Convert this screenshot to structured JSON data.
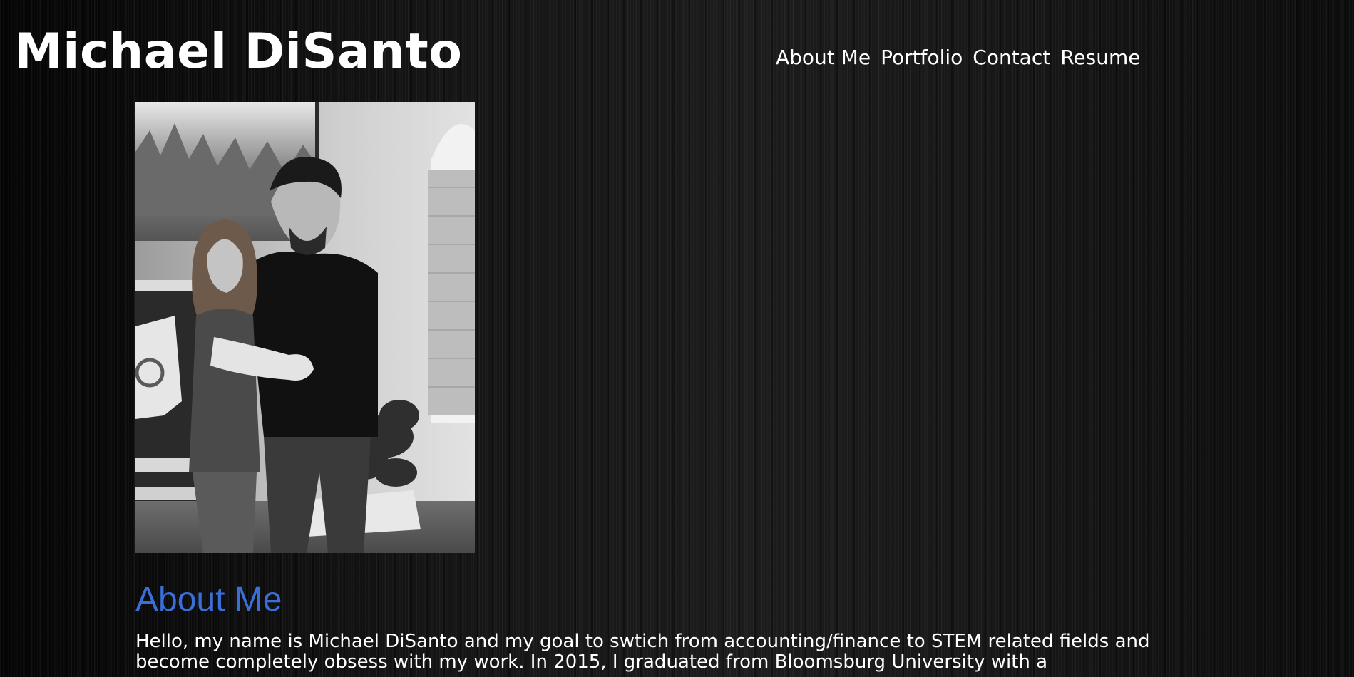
{
  "header": {
    "site_title": "Michael DiSanto",
    "nav": [
      {
        "label": "About Me"
      },
      {
        "label": "Portfolio"
      },
      {
        "label": "Contact"
      },
      {
        "label": "Resume"
      }
    ]
  },
  "main": {
    "section_heading": "About Me",
    "intro_text": "Hello, my name is Michael DiSanto and my goal to swtich from accounting/finance to STEM related fields and become completely obsess with my work. In 2015, I graduated from Bloomsburg University with a"
  },
  "colors": {
    "heading_blue": "#3a6fd9",
    "text_white": "#ffffff",
    "background": "#0b0b0b"
  }
}
